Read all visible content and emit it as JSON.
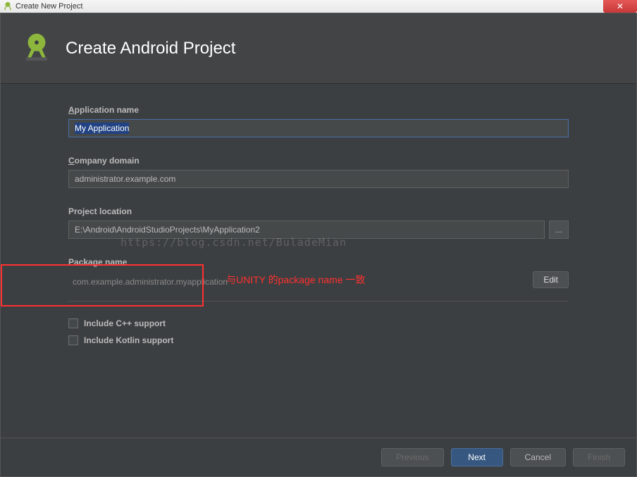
{
  "window": {
    "title": "Create New Project"
  },
  "header": {
    "title": "Create Android Project"
  },
  "form": {
    "app_name_label": "Application name",
    "app_name_value": "My Application",
    "company_label": "Company domain",
    "company_value": "administrator.example.com",
    "location_label": "Project location",
    "location_value": "E:\\Android\\AndroidStudioProjects\\MyApplication2",
    "browse_label": "...",
    "package_label": "Package name",
    "package_value": "com.example.administrator.myapplication",
    "edit_label": "Edit",
    "cpp_label": "Include C++ support",
    "kotlin_label": "Include Kotlin support"
  },
  "footer": {
    "previous": "Previous",
    "next": "Next",
    "cancel": "Cancel",
    "finish": "Finish"
  },
  "annotation": {
    "text": "与UNITY 的package name 一致"
  },
  "watermark": {
    "text": "https://blog.csdn.net/BuladeMian"
  }
}
